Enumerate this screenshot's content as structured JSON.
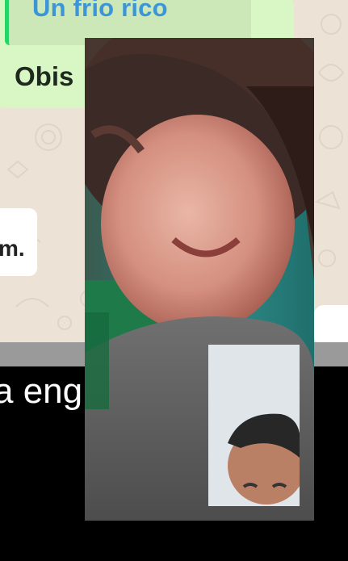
{
  "chat": {
    "quoted_text": "Un frio rico",
    "message_text": "Obis",
    "incoming_fragment": "m."
  },
  "caption": {
    "text": "a eng"
  },
  "video_call": {
    "remote_feed": "remote-participant-video",
    "self_feed": "self-preview-video"
  },
  "colors": {
    "chat_background": "#ece3d6",
    "outgoing_bubble": "#d9f7c4",
    "quote_accent": "#25d366",
    "quote_text": "#3b95d6",
    "divider": "#9a9a9a",
    "caption_background": "#000000"
  }
}
